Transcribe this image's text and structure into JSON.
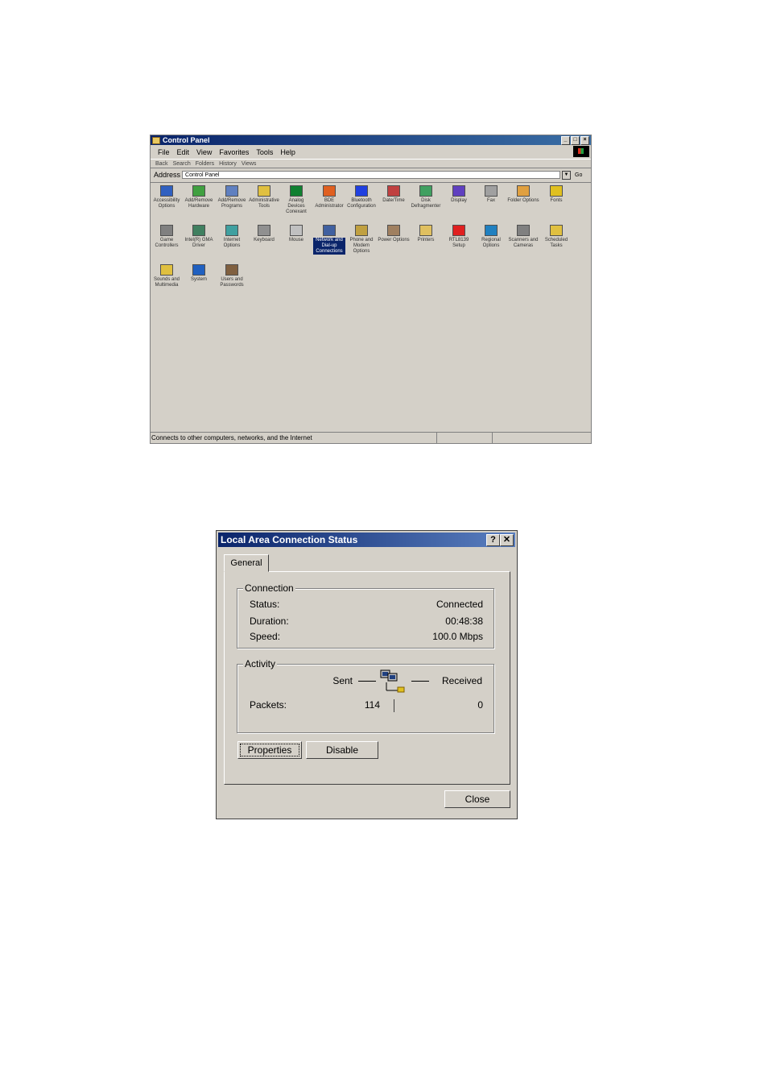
{
  "control_panel": {
    "title": "Control Panel",
    "menu": [
      "File",
      "Edit",
      "View",
      "Favorites",
      "Tools",
      "Help"
    ],
    "toolbar": [
      "Back",
      "Search",
      "Folders",
      "History",
      "Views"
    ],
    "address_label": "Address",
    "address_value": "Control Panel",
    "go_label": "Go",
    "status_text": "Connects to other computers, networks, and the Internet",
    "items": [
      {
        "label": "Accessibility Options",
        "color": "#3060c0"
      },
      {
        "label": "Add/Remove Hardware",
        "color": "#40a040"
      },
      {
        "label": "Add/Remove Programs",
        "color": "#6080c0"
      },
      {
        "label": "Administrative Tools",
        "color": "#e0c040"
      },
      {
        "label": "Analog Devices Conexant",
        "color": "#108030"
      },
      {
        "label": "BDE Administrator",
        "color": "#e06020"
      },
      {
        "label": "Bluetooth Configuration",
        "color": "#2040e0"
      },
      {
        "label": "Date/Time",
        "color": "#c04040"
      },
      {
        "label": "Disk Defragmenter",
        "color": "#40a060"
      },
      {
        "label": "Display",
        "color": "#6040c0"
      },
      {
        "label": "Fax",
        "color": "#a0a0a0"
      },
      {
        "label": "Folder Options",
        "color": "#e0a040"
      },
      {
        "label": "Fonts",
        "color": "#e0c020"
      },
      {
        "label": "Game Controllers",
        "color": "#808080"
      },
      {
        "label": "Intel(R) GMA Driver",
        "color": "#408060"
      },
      {
        "label": "Internet Options",
        "color": "#40a0a0"
      },
      {
        "label": "Keyboard",
        "color": "#909090"
      },
      {
        "label": "Mouse",
        "color": "#c0c0c0"
      },
      {
        "label": "Network and Dial-up Connections",
        "color": "#4060a0",
        "selected": true
      },
      {
        "label": "Phone and Modem Options",
        "color": "#c0a040"
      },
      {
        "label": "Power Options",
        "color": "#a08060"
      },
      {
        "label": "Printers",
        "color": "#e0c060"
      },
      {
        "label": "RTL8139 Setup",
        "color": "#e02020"
      },
      {
        "label": "Regional Options",
        "color": "#2080c0"
      },
      {
        "label": "Scanners and Cameras",
        "color": "#808080"
      },
      {
        "label": "Scheduled Tasks",
        "color": "#e0c040"
      },
      {
        "label": "Sounds and Multimedia",
        "color": "#e0c040"
      },
      {
        "label": "System",
        "color": "#2060c0"
      },
      {
        "label": "Users and Passwords",
        "color": "#806040"
      }
    ]
  },
  "dialog": {
    "title": "Local Area Connection Status",
    "help_btn": "?",
    "close_x": "✕",
    "tab": "General",
    "connection": {
      "group_label": "Connection",
      "status_label": "Status:",
      "status_value": "Connected",
      "duration_label": "Duration:",
      "duration_value": "00:48:38",
      "speed_label": "Speed:",
      "speed_value": "100.0 Mbps"
    },
    "activity": {
      "group_label": "Activity",
      "sent_label": "Sent",
      "received_label": "Received",
      "packets_label": "Packets:",
      "packets_sent": "114",
      "packets_received": "0"
    },
    "buttons": {
      "properties": "Properties",
      "disable": "Disable",
      "close": "Close"
    }
  }
}
